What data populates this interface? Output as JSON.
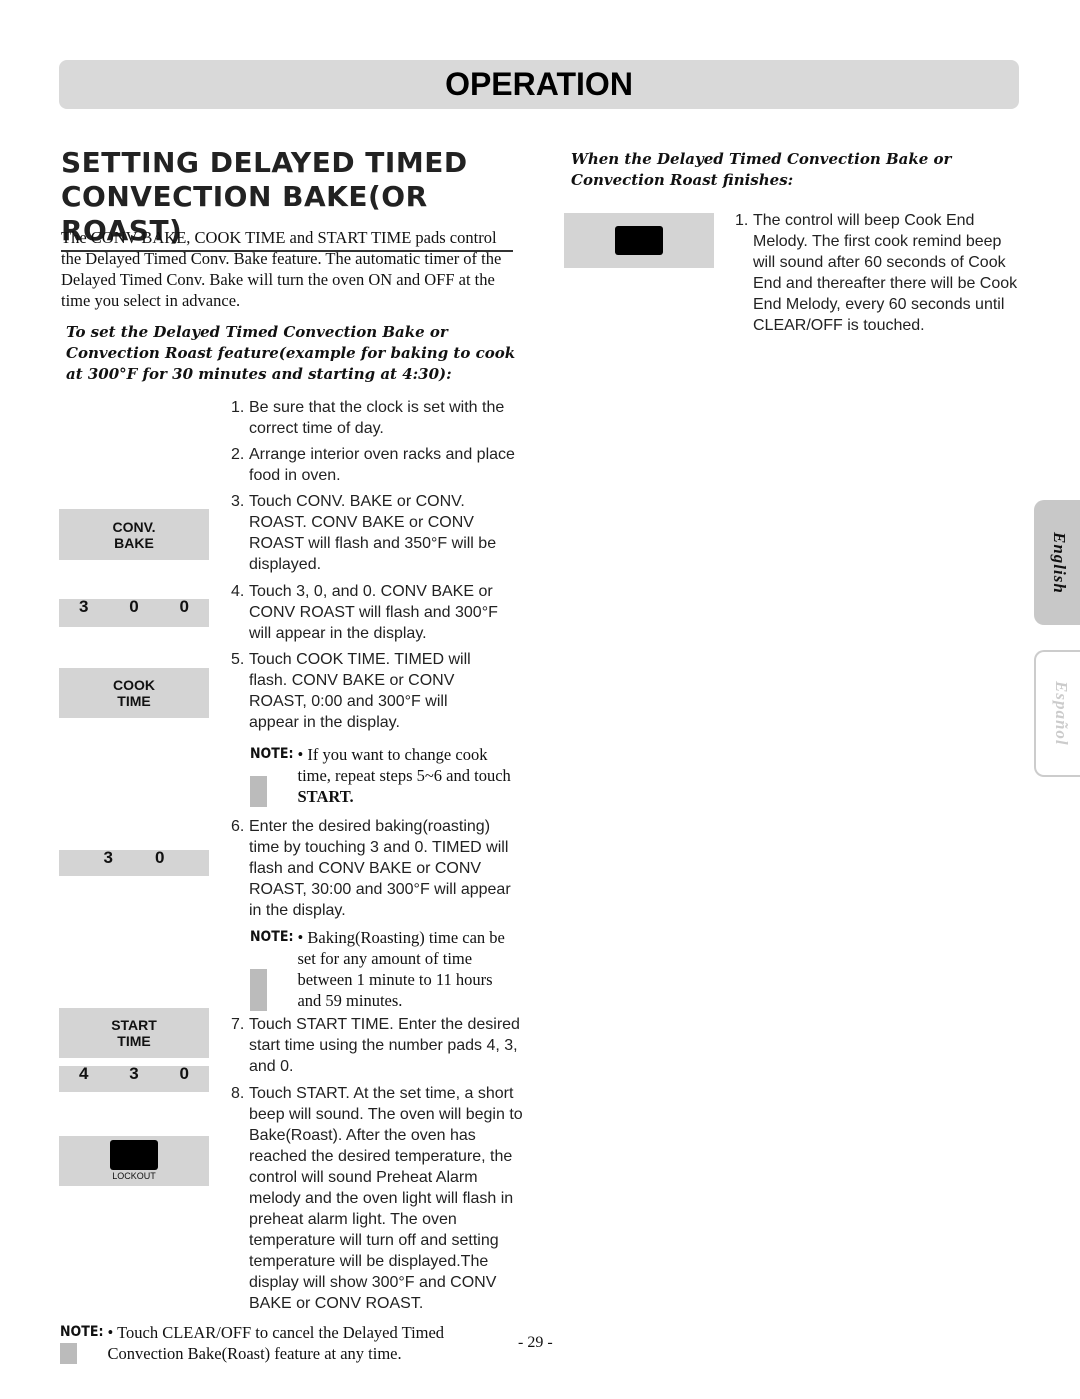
{
  "header": {
    "title": "OPERATION"
  },
  "section": {
    "title": "SETTING DELAYED TIMED CONVECTION BAKE(OR ROAST)",
    "intro": "The CONV BAKE, COOK TIME and START TIME pads control the Delayed Timed Conv. Bake feature. The automatic timer of the Delayed Timed Conv. Bake will turn the oven ON and OFF at the time you select in advance.",
    "instructions_heading": "To set the Delayed Timed Convection Bake or Convection Roast feature(example for baking to cook at 300°F for 30 minutes and starting at 4:30):"
  },
  "pads": {
    "conv_bake": [
      "CONV.",
      "BAKE"
    ],
    "digits_300": [
      "3",
      "0",
      "0"
    ],
    "cook_time": [
      "COOK",
      "TIME"
    ],
    "digits_30": [
      "3",
      "0"
    ],
    "start_time": [
      "START",
      "TIME"
    ],
    "digits_430": [
      "4",
      "3",
      "0"
    ],
    "lockout": "LOCKOUT"
  },
  "steps": [
    {
      "n": "1.",
      "text": "Be sure that the clock is set with the correct time of day."
    },
    {
      "n": "2.",
      "text": "Arrange interior oven racks and place food in oven."
    },
    {
      "n": "3.",
      "text": "Touch CONV. BAKE or CONV. ROAST. CONV BAKE or CONV ROAST will flash and 350°F will be displayed."
    },
    {
      "n": "4.",
      "text": "Touch 3, 0, and 0. CONV BAKE or CONV ROAST will flash and 300°F will appear in the display."
    },
    {
      "n": "5.",
      "text": "Touch COOK TIME. TIMED will flash. CONV BAKE or CONV ROAST, 0:00 and 300°F will appear in the display."
    },
    {
      "n": "6.",
      "text": "Enter the desired baking(roasting) time by touching 3 and 0. TIMED will flash and CONV BAKE or CONV ROAST, 30:00 and 300°F will appear in the display."
    },
    {
      "n": "7.",
      "text": "Touch START TIME. Enter the desired start time using the number pads 4, 3, and 0."
    },
    {
      "n": "8.",
      "text": "Touch START. At the set time, a short beep will sound. The oven will begin to Bake(Roast). After the oven has reached the desired temperature, the control will sound Preheat Alarm melody and the oven light will flash in preheat alarm light. The oven temperature will turn off and setting temperature will be displayed.The display will show 300°F and CONV BAKE or CONV ROAST."
    }
  ],
  "notes": {
    "label": "NOTE:",
    "note1_pre": "• If you want to change cook time, repeat steps 5~6 and touch ",
    "note1_bold": "START.",
    "note2": "• Baking(Roasting) time can be set for any amount of time between 1 minute to 11 hours and 59 minutes.",
    "bottom": "• Touch CLEAR/OFF to cancel the Delayed Timed Convection Bake(Roast) feature at any time."
  },
  "right": {
    "heading": "When the Delayed Timed Convection Bake or Convection Roast finishes:",
    "step": {
      "n": "1.",
      "text": "The control will beep Cook End Melody. The first cook remind beep will sound after 60 seconds of Cook End and thereafter there will be Cook End Melody, every 60 seconds until CLEAR/OFF is touched."
    }
  },
  "page_number": "- 29 -",
  "language_tabs": [
    {
      "label": "English",
      "active": true
    },
    {
      "label": "Español",
      "active": false
    }
  ]
}
